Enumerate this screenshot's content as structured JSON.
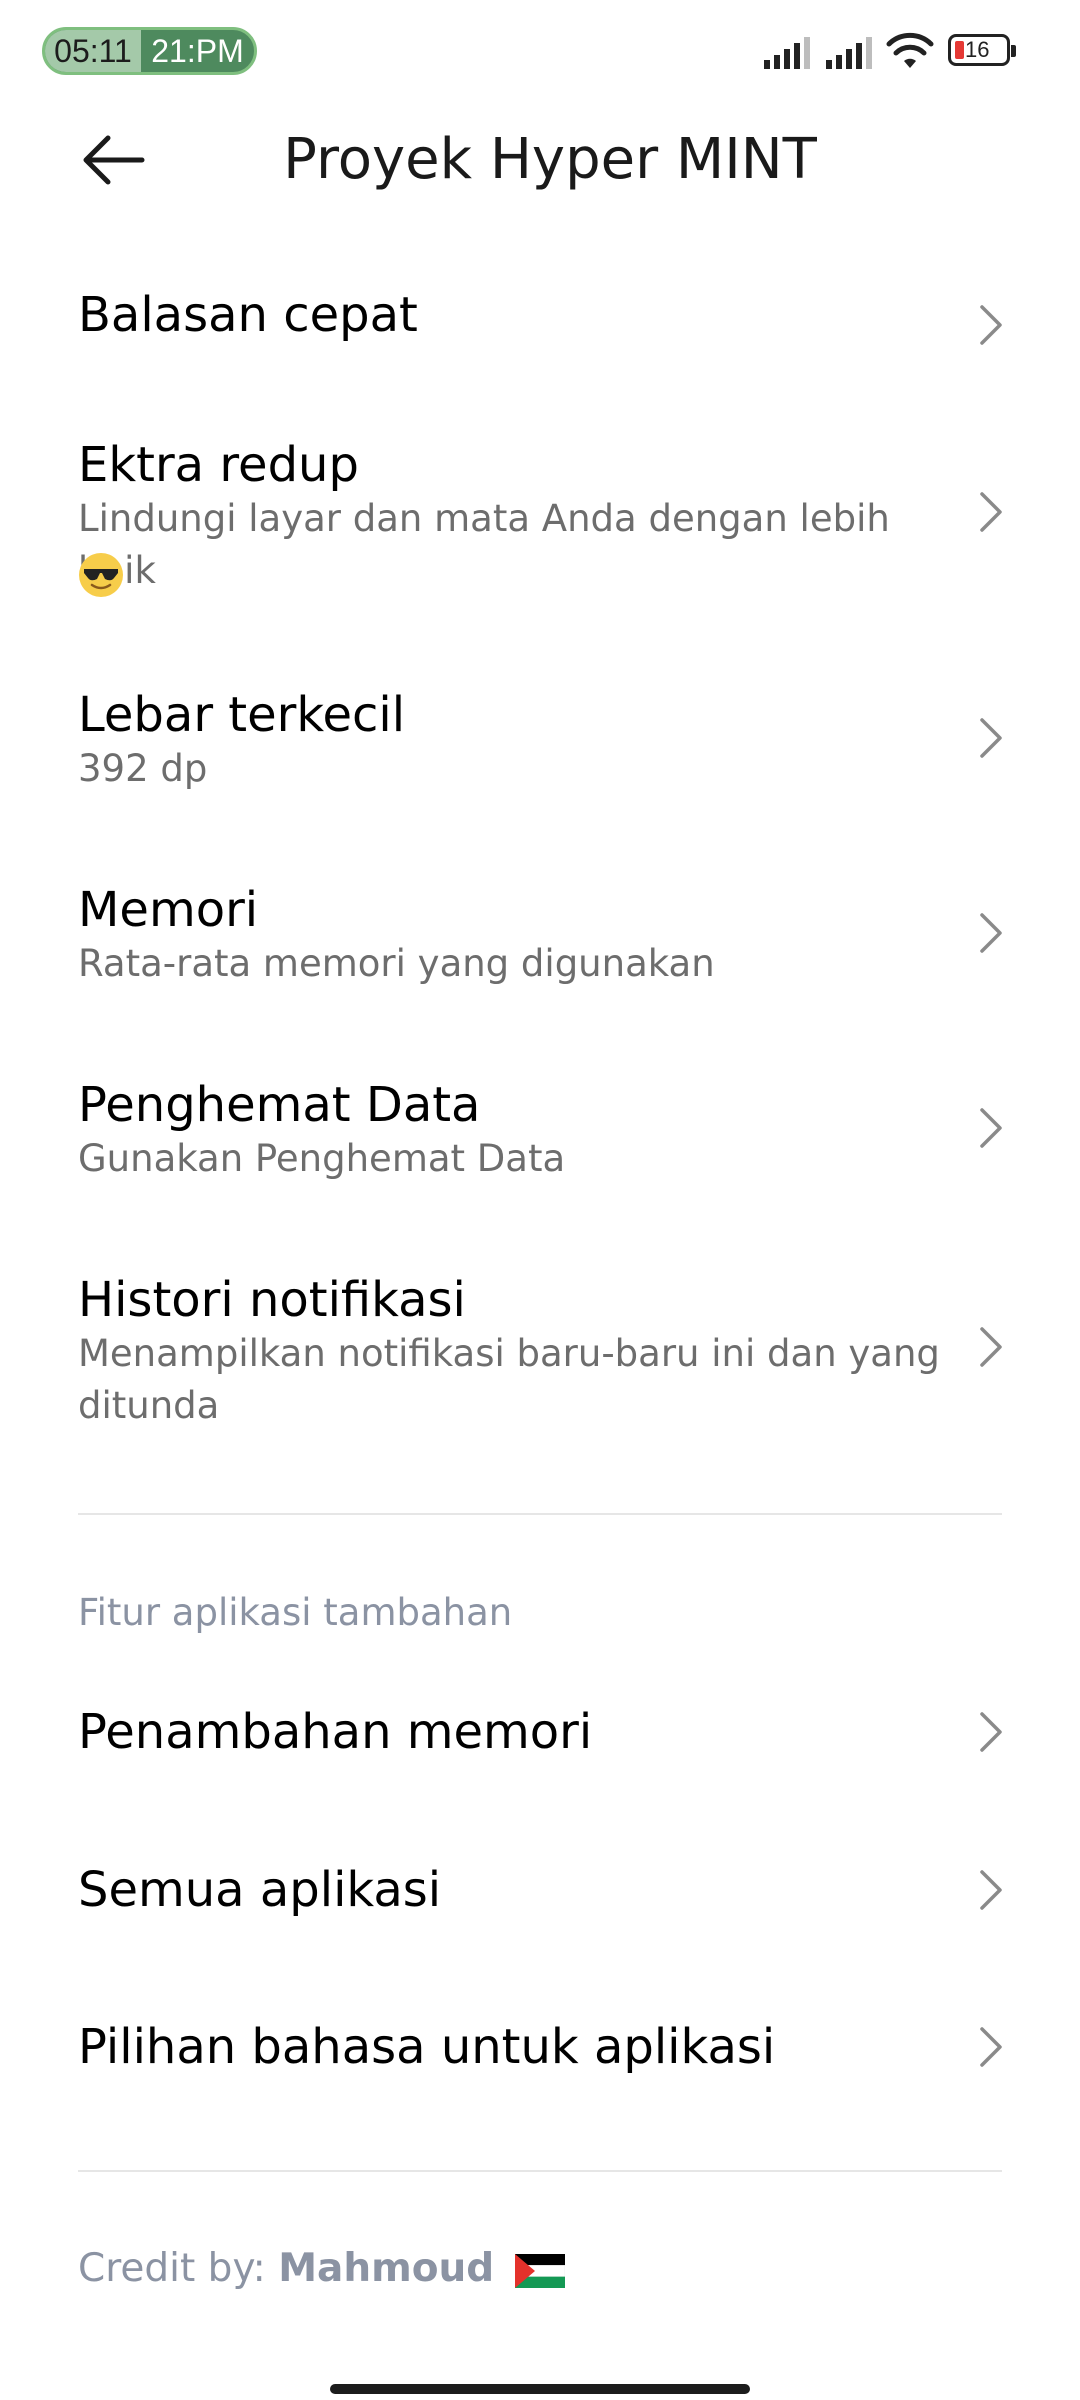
{
  "status_bar": {
    "time_primary": "05:11",
    "time_secondary": "21:PM",
    "battery_level": "16",
    "clock_accent": "#4e8a5e"
  },
  "header": {
    "title": "Proyek Hyper MINT",
    "back_icon": "arrow-left-icon"
  },
  "items": [
    {
      "title": "Balasan cepat",
      "subtitle": ""
    },
    {
      "title": "Ektra redup",
      "subtitle": "Lindungi layar dan mata Anda dengan lebih baik",
      "emoji": "smiling-face-with-sunglasses"
    },
    {
      "title": "Lebar terkecil",
      "subtitle": "392 dp"
    },
    {
      "title": "Memori",
      "subtitle": "Rata-rata memori yang digunakan"
    },
    {
      "title": "Penghemat Data",
      "subtitle": "Gunakan Penghemat Data"
    },
    {
      "title": "Histori notifikasi",
      "subtitle": "Menampilkan notifikasi baru-baru ini dan yang ditunda"
    }
  ],
  "section_label": "Fitur aplikasi tambahan",
  "extra_items": [
    {
      "title": "Penambahan memori"
    },
    {
      "title": "Semua aplikasi"
    },
    {
      "title": "Pilihan bahasa untuk aplikasi"
    }
  ],
  "footer": {
    "credit_prefix": "Credit by: ",
    "credit_name": "Mahmoud",
    "flag_icon": "palestine-flag-icon"
  }
}
